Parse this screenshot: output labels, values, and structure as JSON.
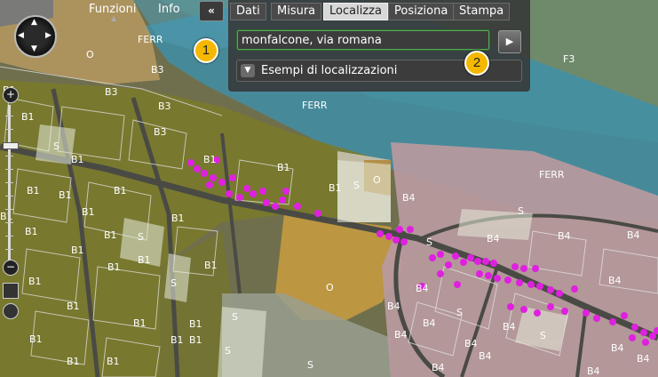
{
  "menu": {
    "functions_label": "Funzioni",
    "info_label": "Info",
    "collapse_label": "«"
  },
  "tabs": [
    {
      "label": "Dati",
      "active": false
    },
    {
      "label": "Misura",
      "active": false
    },
    {
      "label": "Localizza",
      "active": true
    },
    {
      "label": "Posiziona",
      "active": false
    },
    {
      "label": "Stampa",
      "active": false
    }
  ],
  "search": {
    "value": "monfalcone, via romana",
    "go_label": "▶"
  },
  "examples": {
    "label": "Esempi di localizzazioni",
    "toggle_icon": "chevron-down-icon"
  },
  "callouts": [
    "1",
    "2"
  ],
  "map_labels": {
    "ferr_1": "FERR",
    "ferr_2": "FERR",
    "ferr_3": "FERR",
    "f3": "F3",
    "b3_1": "B3",
    "b3_2": "B3",
    "b3_3": "B3",
    "b3_4": "B3",
    "b3_5": "B3",
    "o_1": "O",
    "o_2": "O",
    "o_3": "O",
    "s_1": "S",
    "s_2": "S",
    "s_3": "S",
    "s_4": "S",
    "s_5": "S",
    "s_6": "S",
    "s_7": "S",
    "s_8": "S",
    "s_9": "S",
    "s_10": "S",
    "s_11": "S",
    "b1_1": "B1",
    "b1_2": "B1",
    "b1_3": "B1",
    "b1_4": "B1",
    "b1_5": "B1",
    "b1_6": "B1",
    "b1_7": "B1",
    "b1_8": "B1",
    "b1_9": "B1",
    "b1_10": "B1",
    "b1_11": "B1",
    "b1_12": "B1",
    "b1_13": "B1",
    "b1_14": "B1",
    "b1_15": "B1",
    "b1_16": "B1",
    "b1_17": "B1",
    "b1_18": "B1",
    "b1_19": "B1",
    "b1_20": "B1",
    "b1_21": "B1",
    "b1_22": "B1",
    "b1_23": "B1",
    "b1_24": "B1",
    "b1_25": "B1",
    "b1_26": "B1",
    "b1_27": "B1",
    "b4_1": "B4",
    "b4_2": "B4",
    "b4_3": "B4",
    "b4_4": "B4",
    "b4_5": "B4",
    "b4_6": "B4",
    "b4_7": "B4",
    "b4_8": "B4",
    "b4_9": "B4",
    "b4_10": "B4",
    "b4_11": "B4",
    "b4_12": "B4",
    "b4_13": "B4",
    "b4_14": "B4",
    "b4_15": "B4",
    "b4_16": "B4"
  },
  "colors": {
    "railway_zone": "#3f8fa8",
    "b1_zone": "#7a7a2a",
    "o_zone": "#c49a40",
    "b4_zone": "#b99aa0",
    "result_dots": "#e020e0",
    "callout": "#f5b800"
  },
  "zoom": {
    "in_label": "+",
    "out_label": "−"
  }
}
